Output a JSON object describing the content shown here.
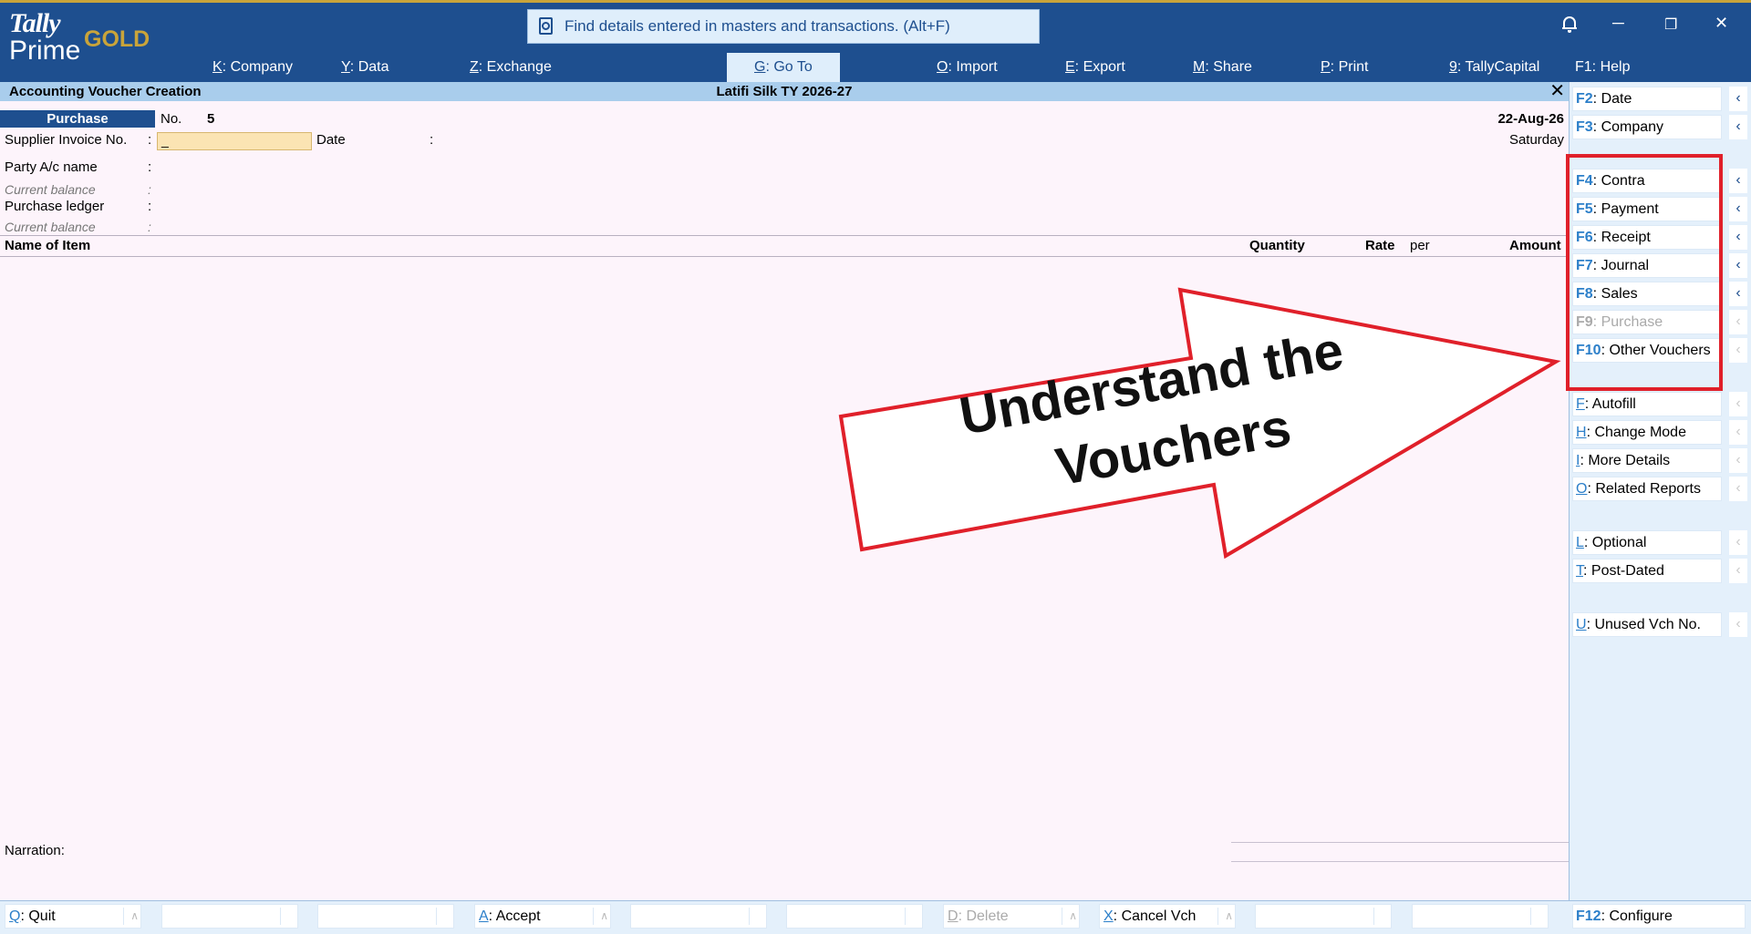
{
  "app": {
    "logo_top": "Tally",
    "logo_bottom": "Prime",
    "edition": "GOLD"
  },
  "search": {
    "placeholder": "Find details entered in masters and transactions. (Alt+F)"
  },
  "window_controls": {
    "minimize": "─",
    "restore": "❐",
    "close": "✕"
  },
  "menu": [
    {
      "key": "K",
      "label": "Company"
    },
    {
      "key": "Y",
      "label": "Data"
    },
    {
      "key": "Z",
      "label": "Exchange"
    },
    {
      "key": "G",
      "label": "Go To"
    },
    {
      "key": "O",
      "label": "Import"
    },
    {
      "key": "E",
      "label": "Export"
    },
    {
      "key": "M",
      "label": "Share"
    },
    {
      "key": "P",
      "label": "Print"
    },
    {
      "key": "9",
      "label": "TallyCapital"
    },
    {
      "key": "F1",
      "label": "Help"
    }
  ],
  "title_strip": {
    "left": "Accounting Voucher Creation",
    "center": "Latifi Silk TY 2026-27",
    "close": "✕"
  },
  "voucher": {
    "type": "Purchase",
    "no_label": "No.",
    "no_value": "5",
    "date": "22-Aug-26",
    "day": "Saturday",
    "supplier_invoice_label": "Supplier Invoice No.",
    "supplier_invoice_value": "_",
    "date_label": "Date",
    "party_label": "Party A/c name",
    "current_balance_label": "Current balance",
    "purchase_ledger_label": "Purchase ledger",
    "current_balance_label_2": "Current balance",
    "colon": ":"
  },
  "columns": {
    "name": "Name of Item",
    "quantity": "Quantity",
    "rate": "Rate",
    "per": "per",
    "amount": "Amount"
  },
  "narration_label": "Narration:",
  "right_panel": [
    {
      "key": "F2",
      "label": "Date",
      "enabled": true
    },
    {
      "key": "F3",
      "label": "Company",
      "enabled": true
    },
    {
      "key": "F4",
      "label": "Contra",
      "enabled": true
    },
    {
      "key": "F5",
      "label": "Payment",
      "enabled": true
    },
    {
      "key": "F6",
      "label": "Receipt",
      "enabled": true
    },
    {
      "key": "F7",
      "label": "Journal",
      "enabled": true
    },
    {
      "key": "F8",
      "label": "Sales",
      "enabled": true
    },
    {
      "key": "F9",
      "label": "Purchase",
      "enabled": false
    },
    {
      "key": "F10",
      "label": "Other Vouchers",
      "enabled": true
    },
    {
      "key": "F",
      "label": "Autofill",
      "enabled": true
    },
    {
      "key": "H",
      "label": "Change Mode",
      "enabled": true
    },
    {
      "key": "I",
      "label": "More Details",
      "enabled": true
    },
    {
      "key": "O",
      "label": "Related Reports",
      "enabled": true
    },
    {
      "key": "L",
      "label": "Optional",
      "enabled": true
    },
    {
      "key": "T",
      "label": "Post-Dated",
      "enabled": true
    },
    {
      "key": "U",
      "label": "Unused Vch No.",
      "enabled": true
    },
    {
      "key": "F12",
      "label": "Configure",
      "enabled": true
    }
  ],
  "bottom_bar": [
    {
      "key": "Q",
      "label": "Quit",
      "enabled": true
    },
    {
      "key": "",
      "label": "",
      "enabled": true
    },
    {
      "key": "",
      "label": "",
      "enabled": true
    },
    {
      "key": "A",
      "label": "Accept",
      "enabled": true
    },
    {
      "key": "",
      "label": "",
      "enabled": true
    },
    {
      "key": "",
      "label": "",
      "enabled": true
    },
    {
      "key": "D",
      "label": "Delete",
      "enabled": false
    },
    {
      "key": "X",
      "label": "Cancel Vch",
      "enabled": true
    },
    {
      "key": "",
      "label": "",
      "enabled": true
    },
    {
      "key": "",
      "label": "",
      "enabled": true
    }
  ],
  "annotation": {
    "line1": "Understand the",
    "line2": "Vouchers",
    "color": "#e0202a"
  },
  "colors": {
    "brand_blue": "#1e4f8f",
    "gold": "#c9a43a",
    "key_blue": "#2c7fc9",
    "background": "#fdf4fb"
  }
}
